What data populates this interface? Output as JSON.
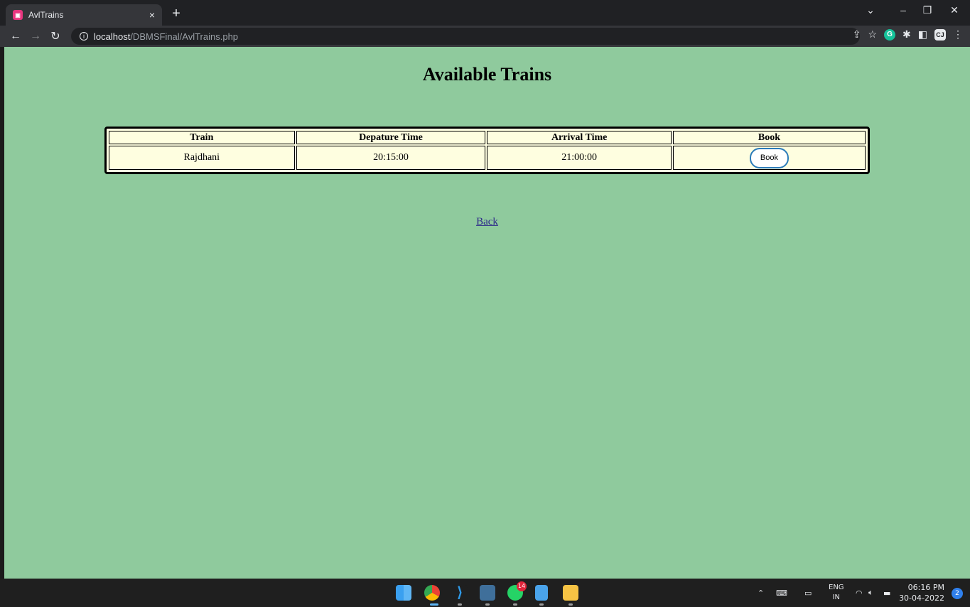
{
  "browser": {
    "tab_title": "AvlTrains",
    "tab_close": "×",
    "new_tab": "+",
    "url_host": "localhost",
    "url_path": "/DBMSFinal/AvlTrains.php",
    "window_controls": [
      "⌄",
      "–",
      "❐",
      "✕"
    ]
  },
  "page": {
    "title": "Available Trains",
    "table": {
      "headers": [
        "Train",
        "Depature Time",
        "Arrival Time",
        "Book"
      ],
      "rows": [
        {
          "train": "Rajdhani",
          "departure": "20:15:00",
          "arrival": "21:00:00",
          "book_label": "Book"
        }
      ]
    },
    "back_label": "Back"
  },
  "taskbar": {
    "whatsapp_badge": "14",
    "lang_top": "ENG",
    "lang_bottom": "IN",
    "time": "06:16 PM",
    "date": "30-04-2022",
    "notification_count": "2"
  },
  "colors": {
    "page_background": "#8fca9d",
    "table_background": "#fefee0",
    "book_button_border": "#2b7bb9",
    "link": "#2e2a8a"
  }
}
